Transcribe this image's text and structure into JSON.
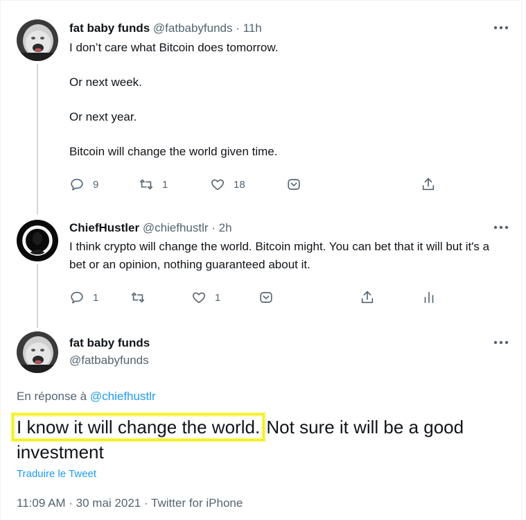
{
  "tweets": [
    {
      "name": "fat baby funds",
      "handle": "@fatbabyfunds",
      "time": "11h",
      "paragraphs": [
        "I don’t care what Bitcoin does tomorrow.",
        "Or next week.",
        "Or next year.",
        "Bitcoin will change the world given time."
      ],
      "replies": "9",
      "retweets": "1",
      "likes": "18"
    },
    {
      "name": "ChiefHustler",
      "handle": "@chiefhustlr",
      "time": "2h",
      "paragraphs": [
        "I think crypto will change the world. Bitcoin might. You can bet that it will but it's a bet or an opinion, nothing guaranteed about it."
      ],
      "replies": "1",
      "retweets": "",
      "likes": "1"
    }
  ],
  "main_tweet": {
    "name": "fat baby funds",
    "handle": "@fatbabyfunds",
    "reply_prefix": "En réponse à",
    "reply_to": "@chiefhustlr",
    "text_highlighted": "I know it will change the world.",
    "text_rest": " Not sure it will be a good investment",
    "translate_label": "Traduire le Tweet",
    "timestamp": "11:09 AM · 30 mai 2021 · Twitter for iPhone"
  },
  "separator": " · ",
  "colors": {
    "accent": "#1d9bf0",
    "muted": "#536471",
    "highlight": "#f4f01f"
  },
  "icons": [
    "more-icon",
    "reply-icon",
    "retweet-icon",
    "like-icon",
    "bookmark-icon",
    "share-icon",
    "analytics-icon"
  ]
}
